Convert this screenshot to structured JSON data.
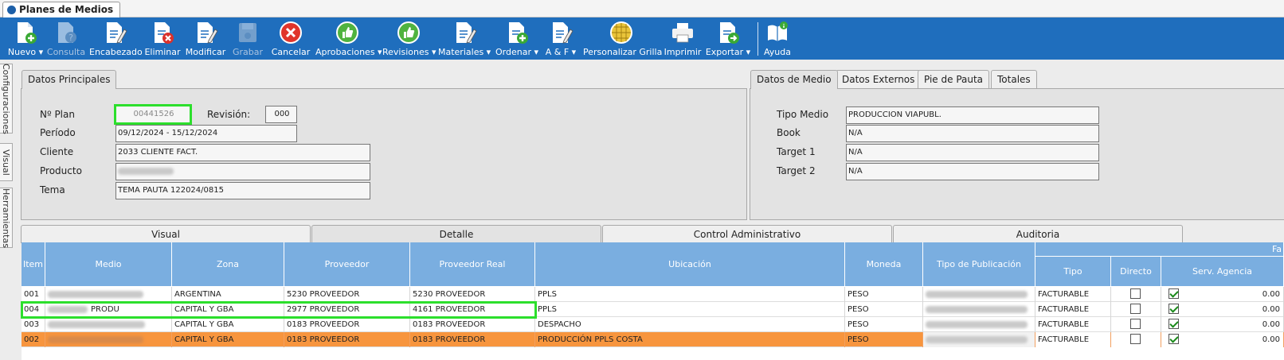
{
  "window": {
    "tab_title": "Planes de Medios"
  },
  "toolbar": {
    "buttons": [
      {
        "label": "Nuevo ▾",
        "icon": "doc-add-icon",
        "enabled": true
      },
      {
        "label": "Consulta",
        "icon": "doc-question-icon",
        "enabled": false
      },
      {
        "label": "Encabezado",
        "icon": "doc-pencil-icon",
        "enabled": true
      },
      {
        "label": "Eliminar",
        "icon": "doc-delete-icon",
        "enabled": true
      },
      {
        "label": "Modificar",
        "icon": "doc-pencil-icon",
        "enabled": true
      },
      {
        "label": "Grabar",
        "icon": "save-icon",
        "enabled": false
      },
      {
        "label": "Cancelar",
        "icon": "cancel-icon",
        "enabled": true
      },
      {
        "label": "Aprobaciones ▾",
        "icon": "thumbs-up-icon",
        "enabled": true
      },
      {
        "label": "Revisiones ▾",
        "icon": "thumbs-up-icon",
        "enabled": true
      },
      {
        "label": "Materiales ▾",
        "icon": "doc-pencil-icon",
        "enabled": true
      },
      {
        "label": "Ordenar ▾",
        "icon": "doc-add-icon",
        "enabled": true
      },
      {
        "label": "A & F ▾",
        "icon": "doc-pencil-icon",
        "enabled": true
      },
      {
        "label": "Personalizar Grilla",
        "icon": "grid-globe-icon",
        "enabled": true
      },
      {
        "label": "Imprimir",
        "icon": "printer-icon",
        "enabled": true
      },
      {
        "label": "Exportar ▾",
        "icon": "export-icon",
        "enabled": true
      },
      {
        "label": "Ayuda",
        "icon": "help-book-icon",
        "enabled": true
      }
    ]
  },
  "side_tabs": [
    "Configuraciones",
    "Visual",
    "Herramientas"
  ],
  "datos_principales": {
    "tab": "Datos Principales",
    "labels": {
      "plan": "Nº Plan",
      "revision": "Revisión:",
      "periodo": "Período",
      "cliente": "Cliente",
      "producto": "Producto",
      "tema": "Tema"
    },
    "values": {
      "plan": "00441526",
      "revision": "000",
      "periodo": "09/12/2024 - 15/12/2024",
      "cliente": "2033 CLIENTE FACT.",
      "producto": "",
      "tema": "TEMA PAUTA 122024/0815"
    }
  },
  "datos_medio": {
    "tabs": [
      "Datos de Medio",
      "Datos Externos",
      "Pie de Pauta",
      "Totales"
    ],
    "labels": {
      "tipo_medio": "Tipo Medio",
      "book": "Book",
      "target1": "Target 1",
      "target2": "Target 2"
    },
    "values": {
      "tipo_medio": "PRODUCCION VIAPUBL.",
      "book": "N/A",
      "target1": "N/A",
      "target2": "N/A"
    }
  },
  "detail_tabs": [
    "Visual",
    "Detalle",
    "Control Administrativo",
    "Auditoria"
  ],
  "grid": {
    "group_header": "Fa",
    "columns": [
      "Item",
      "Medio",
      "Zona",
      "Proveedor",
      "Proveedor Real",
      "Ubicación",
      "Moneda",
      "Tipo de Publicación",
      "Tipo",
      "Directo",
      "Serv. Agencia"
    ],
    "rows": [
      {
        "item": "001",
        "medio": "",
        "zona": "ARGENTINA",
        "proveedor": "5230 PROVEEDOR",
        "proveedor_real": "5230 PROVEEDOR",
        "ubicacion": "PPLS",
        "moneda": "PESO",
        "tipo": "FACTURABLE",
        "directo": false,
        "serv": true,
        "amount": "0.00"
      },
      {
        "item": "004",
        "medio": "PRODU",
        "zona": "CAPITAL Y GBA",
        "proveedor": "2977 PROVEEDOR",
        "proveedor_real": "4161 PROVEEDOR",
        "ubicacion": "PPLS",
        "moneda": "PESO",
        "tipo": "FACTURABLE",
        "directo": false,
        "serv": true,
        "amount": "0.00"
      },
      {
        "item": "003",
        "medio": "",
        "zona": "CAPITAL Y GBA",
        "proveedor": "0183 PROVEEDOR",
        "proveedor_real": "0183 PROVEEDOR",
        "ubicacion": "DESPACHO",
        "moneda": "PESO",
        "tipo": "FACTURABLE",
        "directo": false,
        "serv": true,
        "amount": "0.00"
      },
      {
        "item": "002",
        "medio": "",
        "zona": "CAPITAL Y GBA",
        "proveedor": "0183 PROVEEDOR",
        "proveedor_real": "0183 PROVEEDOR",
        "ubicacion": "PRODUCCIÓN PPLS COSTA",
        "moneda": "PESO",
        "tipo": "FACTURABLE",
        "directo": false,
        "serv": true,
        "amount": "0.00"
      }
    ]
  },
  "colors": {
    "toolbar": "#1f6ebd",
    "grid_header": "#7aaee0",
    "selected_row": "#f7953e",
    "highlight": "#2cdf2c"
  }
}
